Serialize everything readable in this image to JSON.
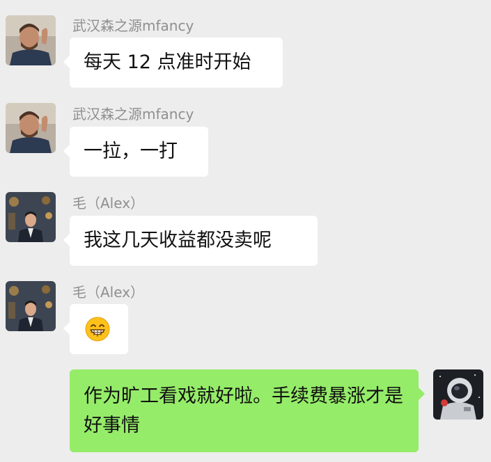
{
  "chat": {
    "messages": [
      {
        "sender": "武汉森之源mfancy",
        "text": "每天 12 点准时开始",
        "side": "left",
        "avatar": "man-portrait-avatar"
      },
      {
        "sender": "武汉森之源mfancy",
        "text": "一拉，一打",
        "side": "left",
        "avatar": "man-portrait-avatar"
      },
      {
        "sender": "毛（Alex）",
        "text": "我这几天收益都没卖呢",
        "side": "left",
        "avatar": "man-suit-avatar"
      },
      {
        "sender": "毛（Alex）",
        "emoji": "grinning-face-emoji",
        "side": "left",
        "avatar": "man-suit-avatar"
      },
      {
        "text": "作为旷工看戏就好啦。手续费暴涨才是好事情",
        "side": "right",
        "avatar": "astronaut-avatar"
      }
    ]
  },
  "colors": {
    "background": "#ededed",
    "bubble_incoming": "#ffffff",
    "bubble_outgoing": "#95ec69",
    "sender_name": "#8f8f8f",
    "message_text": "#111111"
  }
}
